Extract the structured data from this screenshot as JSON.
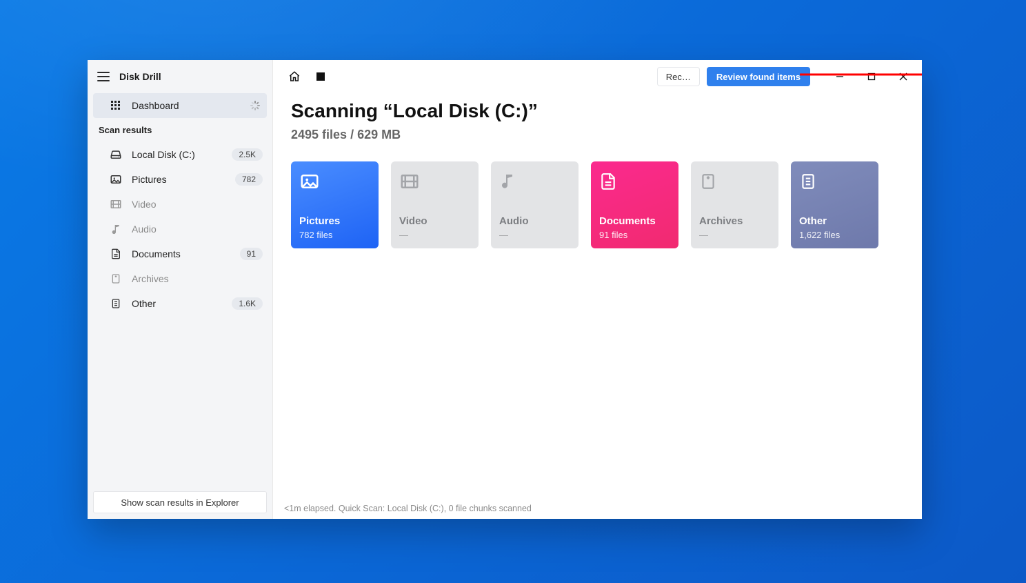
{
  "app": {
    "title": "Disk Drill"
  },
  "sidebar": {
    "dashboard_label": "Dashboard",
    "section_label": "Scan results",
    "items": [
      {
        "label": "Local Disk (C:)",
        "badge": "2.5K"
      },
      {
        "label": "Pictures",
        "badge": "782"
      },
      {
        "label": "Video",
        "badge": ""
      },
      {
        "label": "Audio",
        "badge": ""
      },
      {
        "label": "Documents",
        "badge": "91"
      },
      {
        "label": "Archives",
        "badge": ""
      },
      {
        "label": "Other",
        "badge": "1.6K"
      }
    ],
    "explorer_button": "Show scan results in Explorer"
  },
  "titlebar": {
    "ghost_label": "Rec…",
    "primary_label": "Review found items"
  },
  "page": {
    "title": "Scanning “Local Disk (C:)”",
    "subtitle": "2495 files / 629 MB"
  },
  "cards": [
    {
      "title": "Pictures",
      "sub": "782 files"
    },
    {
      "title": "Video",
      "sub": "—"
    },
    {
      "title": "Audio",
      "sub": "—"
    },
    {
      "title": "Documents",
      "sub": "91 files"
    },
    {
      "title": "Archives",
      "sub": "—"
    },
    {
      "title": "Other",
      "sub": "1,622 files"
    }
  ],
  "status": "<1m elapsed. Quick Scan: Local Disk (C:), 0 file chunks scanned"
}
